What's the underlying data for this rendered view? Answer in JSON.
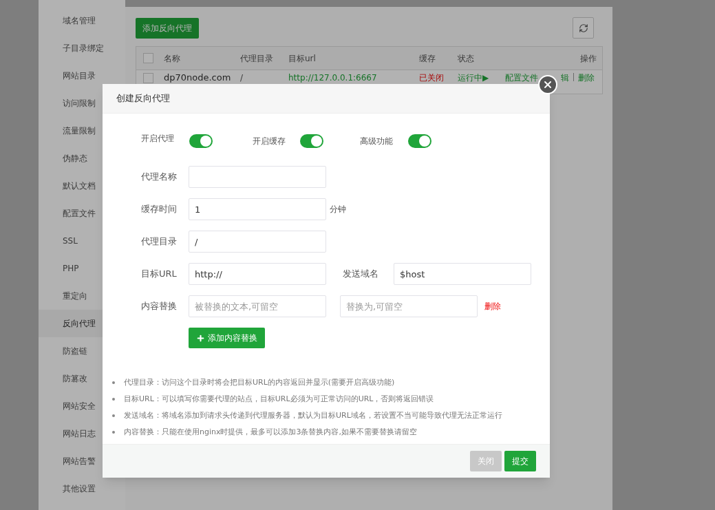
{
  "sidebar": {
    "items": [
      {
        "label": "域名管理",
        "selected": false
      },
      {
        "label": "子目录绑定",
        "selected": false
      },
      {
        "label": "网站目录",
        "selected": false
      },
      {
        "label": "访问限制",
        "selected": false
      },
      {
        "label": "流量限制",
        "selected": false
      },
      {
        "label": "伪静态",
        "selected": false
      },
      {
        "label": "默认文档",
        "selected": false
      },
      {
        "label": "配置文件",
        "selected": false
      },
      {
        "label": "SSL",
        "selected": false
      },
      {
        "label": "PHP",
        "selected": false
      },
      {
        "label": "重定向",
        "selected": false
      },
      {
        "label": "反向代理",
        "selected": true
      },
      {
        "label": "防盗链",
        "selected": false
      },
      {
        "label": "防篡改",
        "selected": false
      },
      {
        "label": "网站安全",
        "selected": false
      },
      {
        "label": "网站日志",
        "selected": false
      },
      {
        "label": "网站告警",
        "selected": false
      },
      {
        "label": "其他设置",
        "selected": false
      }
    ]
  },
  "toolbar": {
    "add_button": "添加反向代理"
  },
  "table": {
    "select_all_checked": false,
    "columns": [
      "名称",
      "代理目录",
      "目标url",
      "缓存",
      "状态",
      "操作"
    ],
    "rows": [
      {
        "checked": false,
        "name": "dp70node.com",
        "dir": "/",
        "url": "http://127.0.0.1:6667",
        "cache": "已关闭",
        "status": "运行中▶",
        "actions": [
          "配置文件",
          "辑",
          "删除"
        ]
      }
    ]
  },
  "dialog": {
    "title": "创建反向代理",
    "switches": [
      {
        "label": "开启代理",
        "on": true
      },
      {
        "label": "开启缓存",
        "on": true
      },
      {
        "label": "高级功能",
        "on": true
      }
    ],
    "name_field": {
      "label": "代理名称"
    },
    "cache_time": {
      "label": "缓存时间",
      "value": "1",
      "unit": "分钟"
    },
    "proxy_dir": {
      "label": "代理目录",
      "value": "/"
    },
    "target_url": {
      "label": "目标URL",
      "value": "http://"
    },
    "send_domain": {
      "label": "发送域名",
      "value": "$host"
    },
    "replace": {
      "label": "内容替换",
      "inputs": [
        {
          "placeholder": "被替换的文本,可留空"
        },
        {
          "placeholder": "替换为,可留空"
        }
      ],
      "delete": "删除"
    },
    "add_replace_button": "添加内容替换",
    "notes": [
      "代理目录：访问这个目录时将会把目标URL的内容返回并显示(需要开启高级功能)",
      "目标URL：可以填写你需要代理的站点，目标URL必须为可正常访问的URL，否则将返回错误",
      "发送域名：将域名添加到请求头传递到代理服务器，默认为目标URL域名，若设置不当可能导致代理无法正常运行",
      "内容替换：只能在使用nginx时提供，最多可以添加3条替换内容,如果不需要替换请留空"
    ],
    "buttons": [
      {
        "label": "关闭",
        "kind": "secondary"
      },
      {
        "label": "提交",
        "kind": "primary"
      }
    ]
  }
}
